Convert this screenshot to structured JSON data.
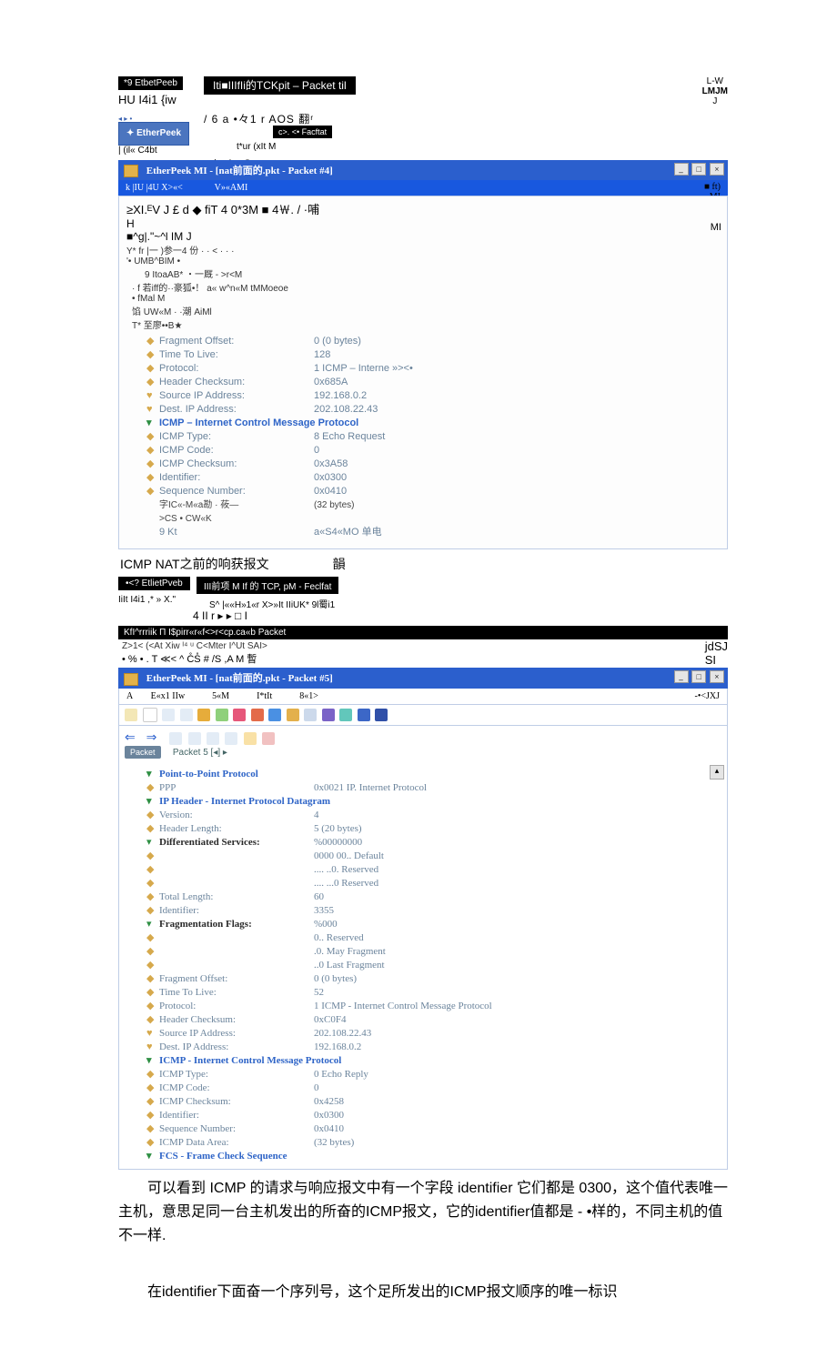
{
  "top1": {
    "popup": "*9 EtbetPeeb",
    "tckpit": "Iti■IIIfIi的TCKpit – Packet til",
    "hu": "HU I4i1 {iw",
    "lw1": "L-W",
    "lw2": "LMJM",
    "lw3": "J",
    "six": "/ 6 a •々1 r AOS  翻ʳ",
    "epeek": "✦ EtherPeek",
    "btns": "◂ ▸ •",
    "facf": "c>. <• Facftat",
    "c4bt": "| (il« C4bt",
    "tur": "t*ur (xIt        M",
    "raos": "/: r A o S »•"
  },
  "tbar1": "EtherPeek MI - [nat前面的.pkt - Packet #4]",
  "blue1": {
    "left": "k |IU |4U X>«<",
    "right": "V»«AMI",
    "rft1": "■ ft)",
    "rft2": "MI"
  },
  "ocr1": {
    "l1": "≥XI.ᴱV J £ d ◆ fiT 4 0*3M ■ 4￦. /        ·哺",
    "l2": "H",
    "l3": "■^g|.\"~^l IM J",
    "l4": "Y* fr            |一 )参一4 份 · · < · · ·",
    "l5": "'• UMB^BIM             •",
    "l6": "9 ItoaAB* ・一厩           -            >r<M",
    "l7": "· f 若iff的··豪狐•！ a« w^n«M tMMoeoe",
    "l8": "• fMal                     M",
    "l9": "馅 UW«M · ·潮          AiMl",
    "l10": "T* 至廖••B★"
  },
  "tree1": [
    {
      "ico": "◆",
      "lbl": "Fragment Offset:",
      "val": "0   (0 bytes)"
    },
    {
      "ico": "◆",
      "lbl": "Time To Live:",
      "val": "128"
    },
    {
      "ico": "◆",
      "lbl": "Protocol:",
      "val": "1  ICMP – Interne          »><•"
    },
    {
      "ico": "◆",
      "lbl": "Header Checksum:",
      "val": "0x685A"
    },
    {
      "ico": "♥",
      "lbl": "Source IP Address:",
      "val": "192.168.0.2"
    },
    {
      "ico": "♥",
      "lbl": "Dest. IP Address:",
      "val": "202.108.22.43"
    },
    {
      "head": true,
      "ico": "▾",
      "lbl": "ICMP – Internet Control Message Protocol"
    },
    {
      "ico": "◆",
      "lbl": "ICMP Type:",
      "val": "8   Echo Request"
    },
    {
      "ico": "◆",
      "lbl": "ICMP Code:",
      "val": "0"
    },
    {
      "ico": "◆",
      "lbl": "ICMP Checksum:",
      "val": "0x3A58"
    },
    {
      "ico": "◆",
      "lbl": "Identifier:",
      "val": "0x0300"
    },
    {
      "ico": "◆",
      "lbl": "Sequence Number:",
      "val": "0x0410"
    },
    {
      "tiny": true,
      "lbl": "字IC«-M«a勘 · 莜—",
      "val": "(32 bytes)"
    },
    {
      "tiny": true,
      "lbl": ">CS •          CW«K",
      "val": ""
    },
    {
      "lbl": "9 Kt",
      "val": "a«S4«MO              单电"
    }
  ],
  "cap1_suffix": "韻",
  "cap1": "ICMP NAT之前的响获报文",
  "mid2": {
    "aLabel": "•<? EtlietPveb",
    "bLabel": "III前项 M If 的 TCP, pM - Feclfat",
    "c": "IiIt I4i1 ,* »    X.\"",
    "d": "S^   |««H»1«r X>»It IIiUK* 9l蜀i1",
    "e": "4                       II r ▸ ▸ □ I"
  },
  "blk3": "KfI^rrriik П I$pirr«r«f<>r<cp.ca«b Packet",
  "ocr2": {
    "a": "Z>1< (<At Xiw   ᴵ⁴ ᵘ           C<Mter I^Ut            SAI>",
    "b": "• % •     . T ≪< ^ C̊S̊ # /S ,A M                      暫",
    "c": "jdSJ",
    "d": "SI"
  },
  "tbar2": "EtherPeek MI - [nat前面的.pkt - Packet #5]",
  "menu2": {
    "a": "A",
    "b": "E«x1 IIw",
    "c": "5«M",
    "d": "I*tIt",
    "e": "8«1>",
    "f": "-•<JXJ"
  },
  "toolbarText": "Packet      5 [◂] ▸",
  "tree2": [
    {
      "head": true,
      "ico": "▾",
      "lbl": "Point-to-Point Protocol"
    },
    {
      "ico": "◆",
      "lbl": "PPP",
      "val": "0x0021  IP. Internet Protocol"
    },
    {
      "head": true,
      "ico": "▾",
      "lbl": "IP Header - Internet Protocol Datagram"
    },
    {
      "ico": "◆",
      "lbl": "Version:",
      "val": "4"
    },
    {
      "ico": "◆",
      "lbl": "Header Length:",
      "val": "5  (20 bytes)"
    },
    {
      "head2": true,
      "ico": "▾",
      "lbl": "Differentiated Services:",
      "val": "%00000000"
    },
    {
      "ico": "◆",
      "lbl": "",
      "val": "0000 00..  Default"
    },
    {
      "ico": "◆",
      "lbl": "",
      "val": ".... ..0.  Reserved"
    },
    {
      "ico": "◆",
      "lbl": "",
      "val": ".... ...0  Reserved"
    },
    {
      "ico": "◆",
      "lbl": "Total Length:",
      "val": "60"
    },
    {
      "ico": "◆",
      "lbl": "Identifier:",
      "val": "3355"
    },
    {
      "head2": true,
      "ico": "▾",
      "lbl": "Fragmentation Flags:",
      "val": "%000"
    },
    {
      "ico": "◆",
      "lbl": "",
      "val": "0..  Reserved"
    },
    {
      "ico": "◆",
      "lbl": "",
      "val": ".0.  May Fragment"
    },
    {
      "ico": "◆",
      "lbl": "",
      "val": "..0  Last Fragment"
    },
    {
      "ico": "◆",
      "lbl": "Fragment Offset:",
      "val": "0  (0 bytes)"
    },
    {
      "ico": "◆",
      "lbl": "Time To Live:",
      "val": "52"
    },
    {
      "ico": "◆",
      "lbl": "Protocol:",
      "val": "1  ICMP - Internet Control Message Protocol"
    },
    {
      "ico": "◆",
      "lbl": "Header Checksum:",
      "val": "0xC0F4"
    },
    {
      "ico": "♥",
      "lbl": "Source IP Address:",
      "val": "202.108.22.43"
    },
    {
      "ico": "♥",
      "lbl": "Dest. IP Address:",
      "val": "192.168.0.2"
    },
    {
      "head": true,
      "ico": "▾",
      "lbl": "ICMP - Internet Control Message Protocol"
    },
    {
      "ico": "◆",
      "lbl": "ICMP Type:",
      "val": "0   Echo Reply"
    },
    {
      "ico": "◆",
      "lbl": "ICMP Code:",
      "val": "0"
    },
    {
      "ico": "◆",
      "lbl": "ICMP Checksum:",
      "val": "0x4258"
    },
    {
      "ico": "◆",
      "lbl": "Identifier:",
      "val": "0x0300"
    },
    {
      "ico": "◆",
      "lbl": "Sequence Number:",
      "val": "0x0410"
    },
    {
      "ico": "◆",
      "lbl": "ICMP Data Area:",
      "val": "(32 bytes)"
    },
    {
      "head": true,
      "ico": "▾",
      "lbl": "FCS - Frame Check Sequence"
    }
  ],
  "para1": "可以看到 ICMP 的请求与响应报文中有一个字段 identifier 它们都是 0300，这个值代表唯一主机，意思足同一台主机发出的所奋的ICMP报文，它的identifier值都是 - •样的，不同主机的值不一样.",
  "para2": "在identifier下面奋一个序列号，这个足所发出的ICMP报文顺序的唯一标识"
}
